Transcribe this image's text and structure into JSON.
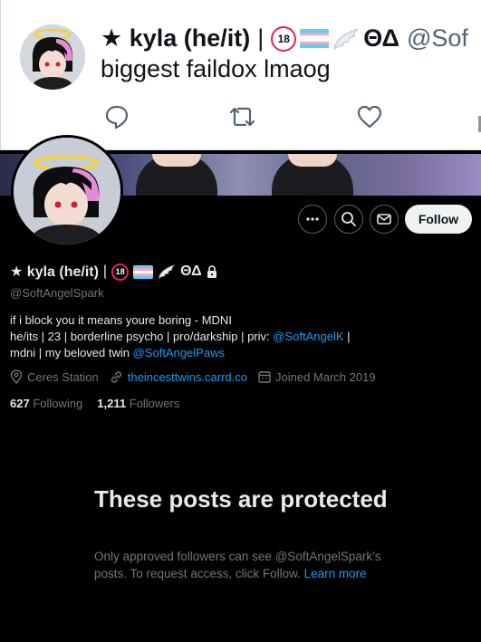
{
  "tweet": {
    "display_name": "★ kyla (he/it)",
    "separator": "|",
    "emoji_suffix": "ΘΔ",
    "handle": "@Sof",
    "text": "biggest faildox lmaog"
  },
  "profile": {
    "display_name": "★ kyla (he/it)",
    "separator": "|",
    "emoji_suffix": "ΘΔ",
    "handle": "@SoftAngelSpark",
    "follow_label": "Follow",
    "bio_line1": "if i block you it means youre boring - MDNI",
    "bio_line2_prefix": "he/its | 23 | borderline psycho | pro/darkship | priv: ",
    "bio_line2_link": "@SoftAngelK",
    "bio_line2_suffix": " |",
    "bio_line3_prefix": "mdni | my beloved twin ",
    "bio_line3_link": "@SoftAngelPaws",
    "location": "Ceres Station",
    "website": "theincesttwins.carrd.co",
    "joined": "Joined March 2019",
    "following_count": "627",
    "following_label": "Following",
    "followers_count": "1,211",
    "followers_label": "Followers"
  },
  "protected": {
    "title": "These posts are protected",
    "body": "Only approved followers can see @SoftAngelSpark’s posts. To request access, click Follow. ",
    "learn_more": "Learn more"
  },
  "icons": [
    "reply-icon",
    "retweet-icon",
    "like-icon",
    "more-icon",
    "search-icon",
    "message-icon",
    "location-icon",
    "link-icon",
    "calendar-icon",
    "lock-icon"
  ],
  "colors": {
    "accent": "#1d9bf0",
    "text_dark": "#e7e9ea",
    "muted": "#71767b",
    "badge_red": "#e0245e"
  }
}
